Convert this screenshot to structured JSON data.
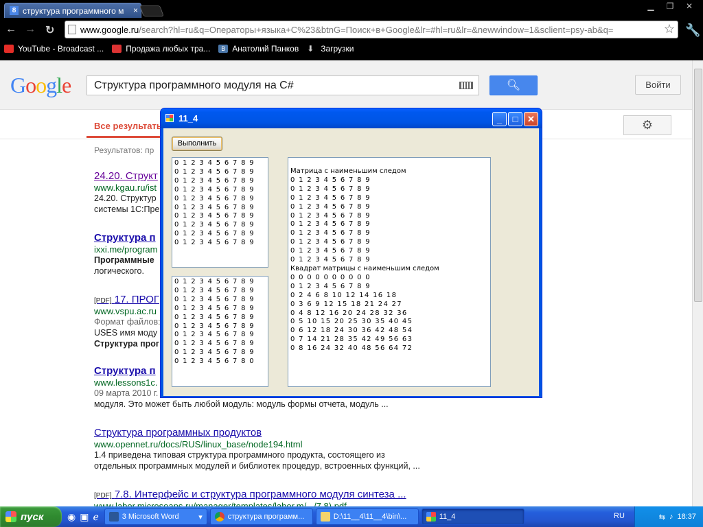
{
  "browser": {
    "tab_title": "структура программного м",
    "tab_favicon": "8",
    "url_host": "www.google.ru",
    "url_path": "/search?hl=ru&q=Операторы+языка+C%23&btnG=Поиск+в+Google&lr=#hl=ru&lr=&newwindow=1&sclient=psy-ab&q=",
    "bookmarks": [
      "YouTube - Broadcast ...",
      "Продажа любых тра...",
      "Анатолий Панков",
      "Загрузки"
    ]
  },
  "google": {
    "logo": "Google",
    "query": "Структура программного модуля на C#",
    "login_label": "Войти",
    "all_results": "Все результаты",
    "stats": "Результатов: пр",
    "results": [
      {
        "title": "24.20. Структ",
        "url": "www.kgau.ru/ist",
        "snippet": [
          "24.20. Структур",
          "системы 1С:Пре"
        ]
      },
      {
        "title": "Структура п",
        "url": "ixxi.me/program",
        "snippet": [
          "Программные",
          "логического."
        ]
      },
      {
        "pdf": "[PDF]",
        "title": "17. ПРОГ",
        "url": "www.vspu.ac.ru",
        "snippet": [
          "Формат файлов:",
          "USES имя моду",
          "Структура прог"
        ]
      },
      {
        "title": "Структура п",
        "url": "www.lessons1c.",
        "snippet": [
          "09 марта 2010 г.",
          "модуля. Это может быть любой модуль: модуль формы отчета, модуль ..."
        ]
      },
      {
        "title": "Структура программных продуктов",
        "url": "www.opennet.ru/docs/RUS/linux_base/node194.html",
        "snippet": [
          "1.4 приведена типовая структура программного продукта, состоящего из",
          "отдельных программных модулей и библиотек процедур, встроенных функций, ..."
        ]
      },
      {
        "pdf": "[PDF]",
        "title": "7.8. Интерфейс и структура программного модуля синтеза ...",
        "url": "www.labor.microsoaps.ru/manager/templates/labor.m/.../7.8).pdf",
        "snippet": []
      }
    ]
  },
  "app": {
    "title": "11_4",
    "run_label": "Выполнить",
    "box1": [
      "0 1 2 3 4 5 6 7 8 9",
      "0 1 2 3 4 5 6 7 8 9",
      "0 1 2 3 4 5 6 7 8 9",
      "0 1 2 3 4 5 6 7 8 9",
      "0 1 2 3 4 5 6 7 8 9",
      "0 1 2 3 4 5 6 7 8 9",
      "0 1 2 3 4 5 6 7 8 9",
      "0 1 2 3 4 5 6 7 8 9",
      "0 1 2 3 4 5 6 7 8 9",
      "0 1 2 3 4 5 6 7 8 9"
    ],
    "box2": [
      "0 1 2 3 4 5 6 7 8 9",
      "0 1 2 3 4 5 6 7 8 9",
      "0 1 2 3 4 5 6 7 8 9",
      "0 1 2 3 4 5 6 7 8 9",
      "0 1 2 3 4 5 6 7 8 9",
      "0 1 2 3 4 5 6 7 8 9",
      "0 1 2 3 4 5 6 7 8 9",
      "0 1 2 3 4 5 6 7 8 9",
      "0 1 2 3 4 5 6 7 8 9",
      "0 1 2 3 4 5 6 7 8 0"
    ],
    "box3_heading1": "Матрица с наименьшим следом",
    "box3_matrix": [
      "0 1 2 3 4 5 6 7 8 9",
      "0 1 2 3 4 5 6 7 8 9",
      "0 1 2 3 4 5 6 7 8 9",
      "0 1 2 3 4 5 6 7 8 9",
      "0 1 2 3 4 5 6 7 8 9",
      "0 1 2 3 4 5 6 7 8 9",
      "0 1 2 3 4 5 6 7 8 9",
      "0 1 2 3 4 5 6 7 8 9",
      "0 1 2 3 4 5 6 7 8 9",
      "0 1 2 3 4 5 6 7 8 9"
    ],
    "box3_heading2": "Квадрат матрицы с наименьшим следом",
    "box3_square": [
      "0 0 0 0 0 0 0 0 0 0",
      "0 1 2 3 4 5 6 7 8 9",
      "0 2 4 6 8 10 12 14 16 18",
      "0 3 6 9 12 15 18 21 24 27",
      "0 4 8 12 16 20 24 28 32 36",
      "0 5 10 15 20 25 30 35 40 45",
      "0 6 12 18 24 30 36 42 48 54",
      "0 7 14 21 28 35 42 49 56 63",
      "0 8 16 24 32 40 48 56 64 72"
    ]
  },
  "taskbar": {
    "start_label": "пуск",
    "items": [
      "3 Microsoft Word",
      "структура программ...",
      "D:\\11__4\\11__4\\bin\\...",
      "11_4"
    ],
    "lang": "RU",
    "clock": "18:37"
  }
}
